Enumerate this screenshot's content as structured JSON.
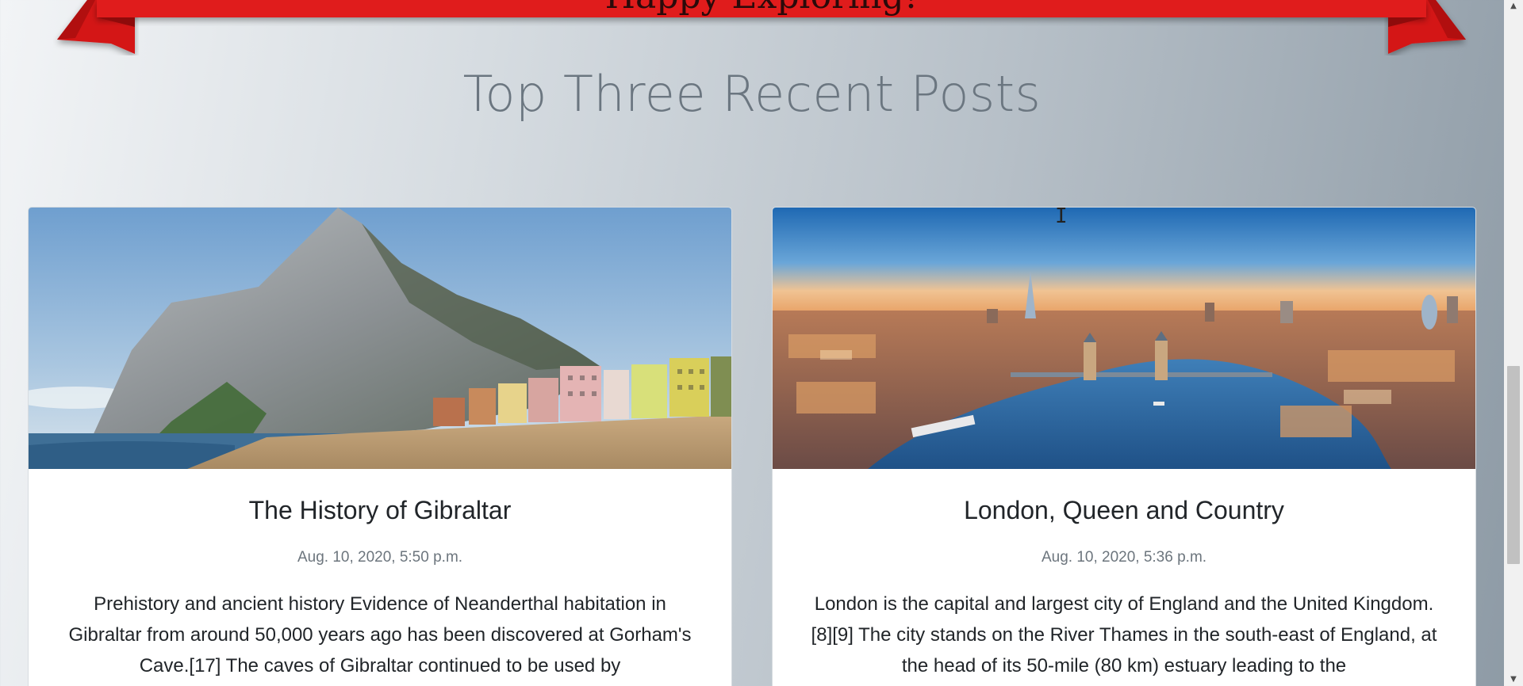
{
  "banner": {
    "text": "Happy Exploring!"
  },
  "section": {
    "title": "Top Three Recent Posts"
  },
  "posts": [
    {
      "title": "The History of Gibraltar",
      "date": "Aug. 10, 2020, 5:50 p.m.",
      "excerpt": "Prehistory and ancient history Evidence of Neanderthal habitation in Gibraltar from around 50,000 years ago has been discovered at Gorham's Cave.[17] The caves of Gibraltar continued to be used by",
      "image_alt": "Rock of Gibraltar with beach and colourful buildings"
    },
    {
      "title": "London, Queen and Country",
      "date": "Aug. 10, 2020, 5:36 p.m.",
      "excerpt": "London is the capital and largest city of England and the United Kingdom.[8][9] The city stands on the River Thames in the south-east of England, at the head of its 50-mile (80 km) estuary leading to the",
      "image_alt": "Aerial view of London with Tower Bridge and the Shard"
    }
  ],
  "colors": {
    "ribbon": "#e01b1b",
    "ribbon_dark": "#a50f0f",
    "title": "#6b7680"
  },
  "icons": {
    "cursor": "text-cursor-icon",
    "scroll_up": "triangle-up-icon",
    "scroll_down": "triangle-down-icon"
  }
}
